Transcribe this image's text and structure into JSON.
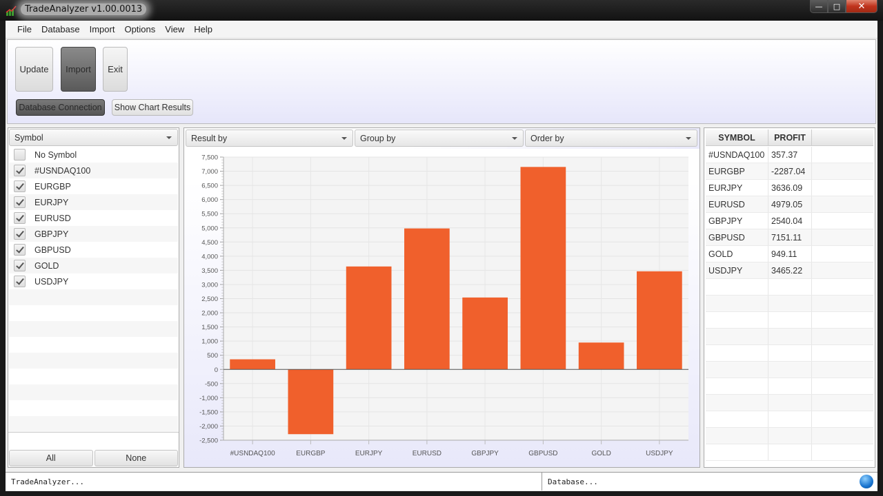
{
  "window": {
    "title": "TradeAnalyzer v1.00.0013",
    "controls": {
      "minimize": "—",
      "maximize": "□",
      "close": "✕"
    }
  },
  "menu": [
    "File",
    "Database",
    "Import",
    "Options",
    "View",
    "Help"
  ],
  "toolbar": {
    "update_label": "Update",
    "import_label": "Import",
    "exit_label": "Exit",
    "db_connection_label": "Database Connection",
    "show_chart_label": "Show Chart Results"
  },
  "left_panel": {
    "combo_label": "Symbol",
    "symbols": [
      {
        "label": "No Symbol",
        "checked": false
      },
      {
        "label": "#USNDAQ100",
        "checked": true
      },
      {
        "label": "EURGBP",
        "checked": true
      },
      {
        "label": "EURJPY",
        "checked": true
      },
      {
        "label": "EURUSD",
        "checked": true
      },
      {
        "label": "GBPJPY",
        "checked": true
      },
      {
        "label": "GBPUSD",
        "checked": true
      },
      {
        "label": "GOLD",
        "checked": true
      },
      {
        "label": "USDJPY",
        "checked": true
      }
    ],
    "all_label": "All",
    "none_label": "None"
  },
  "center_panel": {
    "result_by": "Result by",
    "group_by": "Group by",
    "order_by": "Order by"
  },
  "chart_data": {
    "type": "bar",
    "title": "",
    "xlabel": "",
    "ylabel": "",
    "categories": [
      "#USNDAQ100",
      "EURGBP",
      "EURJPY",
      "EURUSD",
      "GBPJPY",
      "GBPUSD",
      "GOLD",
      "USDJPY"
    ],
    "values": [
      357.37,
      -2287.04,
      3636.09,
      4979.05,
      2540.04,
      7151.11,
      949.11,
      3465.22
    ],
    "ylim": [
      -2500,
      7500
    ],
    "yticks": [
      -2500,
      -2000,
      -1500,
      -1000,
      -500,
      0,
      500,
      1000,
      1500,
      2000,
      2500,
      3000,
      3500,
      4000,
      4500,
      5000,
      5500,
      6000,
      6500,
      7000,
      7500
    ],
    "ytick_labels": [
      "-2,500",
      "-2,000",
      "-1,500",
      "-1,000",
      "-500",
      "0",
      "500",
      "1,000",
      "1,500",
      "2,000",
      "2,500",
      "3,000",
      "3,500",
      "4,000",
      "4,500",
      "5,000",
      "5,500",
      "6,000",
      "6,500",
      "7,000",
      "7,500"
    ],
    "grid": true,
    "legend": "none",
    "bar_color": "#f0602c"
  },
  "right_panel": {
    "headers": [
      "SYMBOL",
      "PROFIT"
    ],
    "rows": [
      [
        "#USNDAQ100",
        "357.37"
      ],
      [
        "EURGBP",
        "-2287.04"
      ],
      [
        "EURJPY",
        "3636.09"
      ],
      [
        "EURUSD",
        "4979.05"
      ],
      [
        "GBPJPY",
        "2540.04"
      ],
      [
        "GBPUSD",
        "7151.11"
      ],
      [
        "GOLD",
        "949.11"
      ],
      [
        "USDJPY",
        "3465.22"
      ]
    ],
    "empty_rows": 11
  },
  "status": {
    "left": "TradeAnalyzer...",
    "right": "Database..."
  }
}
